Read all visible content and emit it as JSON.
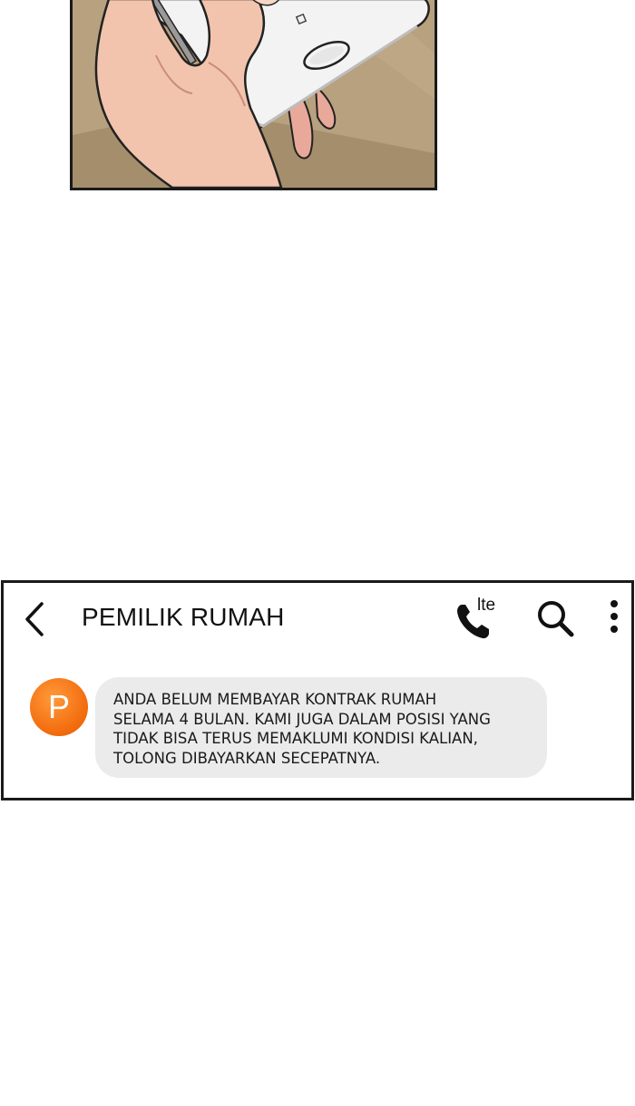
{
  "contact_name": "PEMILIK RUMAH",
  "call_badge": "lte",
  "avatar_letter": "P",
  "message_lines": [
    "ANDA BELUM MEMBAYAR KONTRAK RUMAH",
    "SELAMA 4 BULAN. KAMI JUGA DALAM POSISI YANG",
    "TIDAK BISA TERUS MEMAKLUMI KONDISI KALIAN,",
    "TOLONG DIBAYARKAN SECEPATNYA."
  ],
  "icons": {
    "back": "chevron-left-icon",
    "call": "phone-icon",
    "search": "search-icon",
    "more": "more-vertical-icon"
  },
  "colors": {
    "avatar": "#f26a0c",
    "bubble": "#ebebeb",
    "border": "#1a1a1a"
  }
}
